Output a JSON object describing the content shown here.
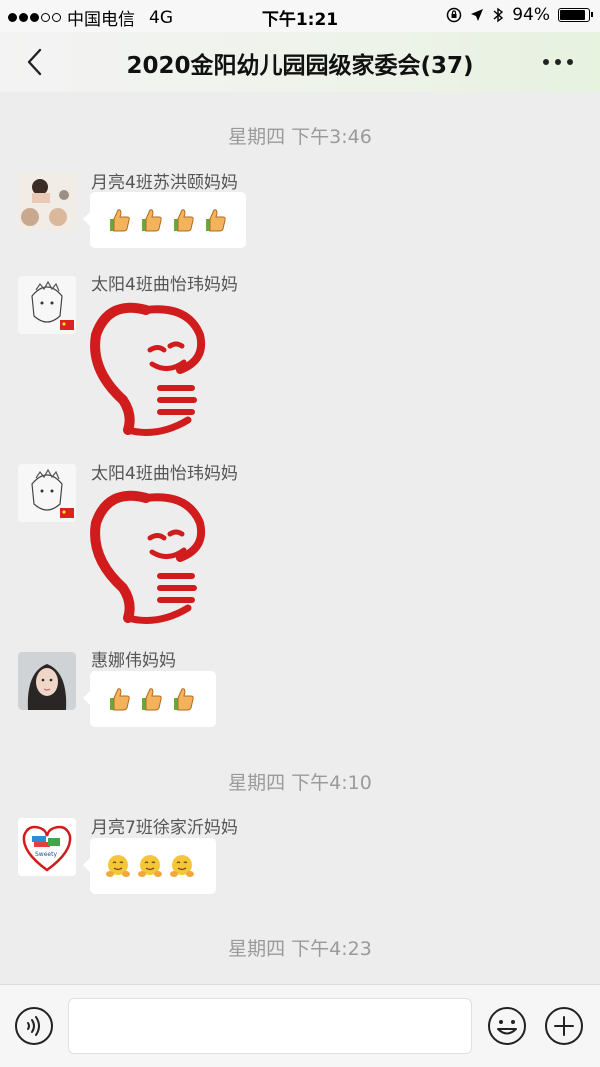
{
  "status_bar": {
    "carrier": "中国电信",
    "network": "4G",
    "time": "下午1:21",
    "battery_pct": "94%",
    "battery_level": 0.94
  },
  "nav": {
    "title": "2020金阳幼儿园园级家委会(37)",
    "back_icon": "chevron-left-icon",
    "more_icon": "more-dots-icon"
  },
  "chat": {
    "time_labels": [
      "星期四 下午3:46",
      "星期四 下午4:10",
      "星期四 下午4:23"
    ],
    "messages": [
      {
        "sender": "月亮4班苏洪颐妈妈",
        "content": "thumbs-up x4"
      },
      {
        "sender": "太阳4班曲怡玮妈妈",
        "content": "sticker"
      },
      {
        "sender": "太阳4班曲怡玮妈妈",
        "content": "sticker"
      },
      {
        "sender": "惠娜伟妈妈",
        "content": "thumbs-up x3"
      },
      {
        "sender": "月亮7班徐家沂妈妈",
        "content": "hugging-face x3"
      }
    ]
  },
  "input_bar": {
    "voice_icon": "voice-icon",
    "emoji_icon": "smile-icon",
    "add_icon": "plus-icon"
  }
}
